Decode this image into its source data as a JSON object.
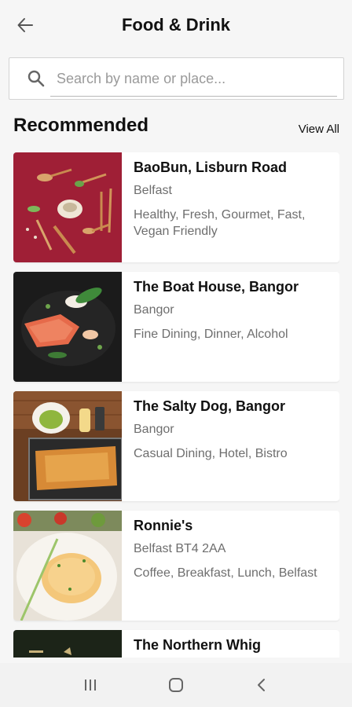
{
  "header": {
    "title": "Food & Drink",
    "back_icon": "arrow-left-icon"
  },
  "search": {
    "placeholder": "Search by name or place...",
    "value": "",
    "icon": "search-icon"
  },
  "section": {
    "title": "Recommended",
    "view_all": "View All"
  },
  "places": [
    {
      "name": "BaoBun, Lisburn Road",
      "location": "Belfast",
      "tags": "Healthy, Fresh, Gourmet, Fast, Vegan Friendly"
    },
    {
      "name": "The Boat House, Bangor",
      "location": "Bangor",
      "tags": "Fine Dining, Dinner, Alcohol"
    },
    {
      "name": "The Salty Dog, Bangor",
      "location": "Bangor",
      "tags": "Casual Dining, Hotel, Bistro"
    },
    {
      "name": "Ronnie's",
      "location": "Belfast BT4 2AA",
      "tags": "Coffee, Breakfast, Lunch, Belfast"
    },
    {
      "name": "The Northern Whig",
      "location": "",
      "tags": ""
    }
  ],
  "navbar": {
    "icons": [
      "recent-apps-icon",
      "home-icon",
      "back-icon"
    ]
  },
  "colors": {
    "background": "#f6f6f6",
    "card": "#ffffff",
    "muted_text": "#6e6e6e"
  }
}
